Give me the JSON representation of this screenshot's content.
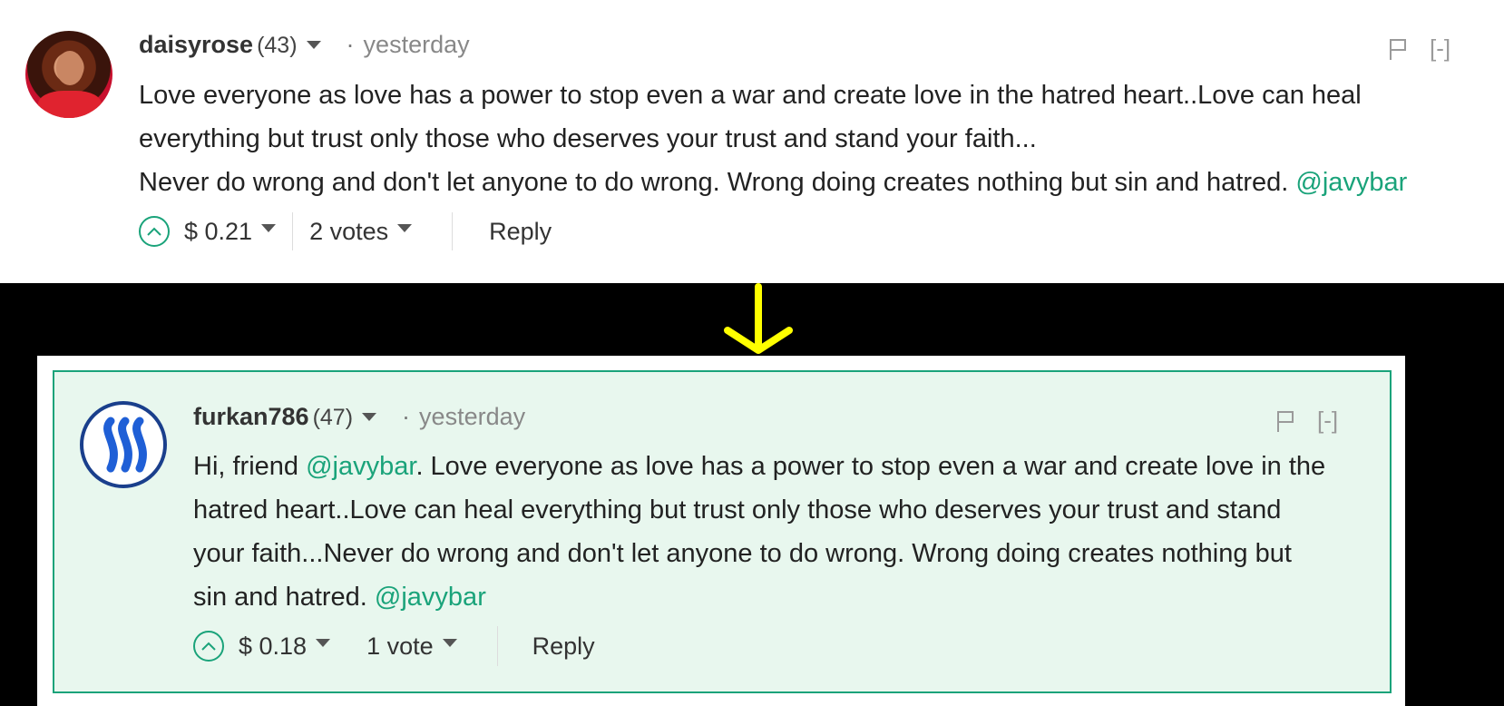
{
  "top_comment": {
    "author": "daisyrose",
    "reputation": "(43)",
    "dot": "·",
    "time": "yesterday",
    "collapse_label": "[-]",
    "body_line1": "Love everyone as love has a power to stop even a war and create love in the hatred heart..Love can heal",
    "body_line2": "everything but trust only those who deserves your trust and stand your faith...",
    "body_line3": "Never do wrong and don't let anyone to do wrong. Wrong doing creates nothing but sin and hatred.",
    "mention": "@javybar",
    "payout": "$ 0.21",
    "votes": "2 votes",
    "reply_label": "Reply"
  },
  "reply_comment": {
    "author": "furkan786",
    "reputation": "(47)",
    "dot": "·",
    "time": "yesterday",
    "collapse_label": "[-]",
    "greeting": "Hi, friend",
    "mention_1": "@javybar",
    "body_line1_rest": ". Love everyone as love has a power to stop even a war and create love in the",
    "body_line2": "hatred heart..Love can heal everything but trust only those who deserves your trust and stand",
    "body_line3": "your faith...Never do wrong and don't let anyone to do wrong. Wrong doing creates nothing but",
    "body_line4": "sin and hatred.",
    "mention_2": "@javybar",
    "payout": "$ 0.18",
    "votes": "1 vote",
    "reply_label": "Reply"
  },
  "colors": {
    "accent": "#1aa37a",
    "highlight_bg": "#e8f7ee",
    "arrow": "#ffff00",
    "steem_blue": "#1a3f8c"
  }
}
